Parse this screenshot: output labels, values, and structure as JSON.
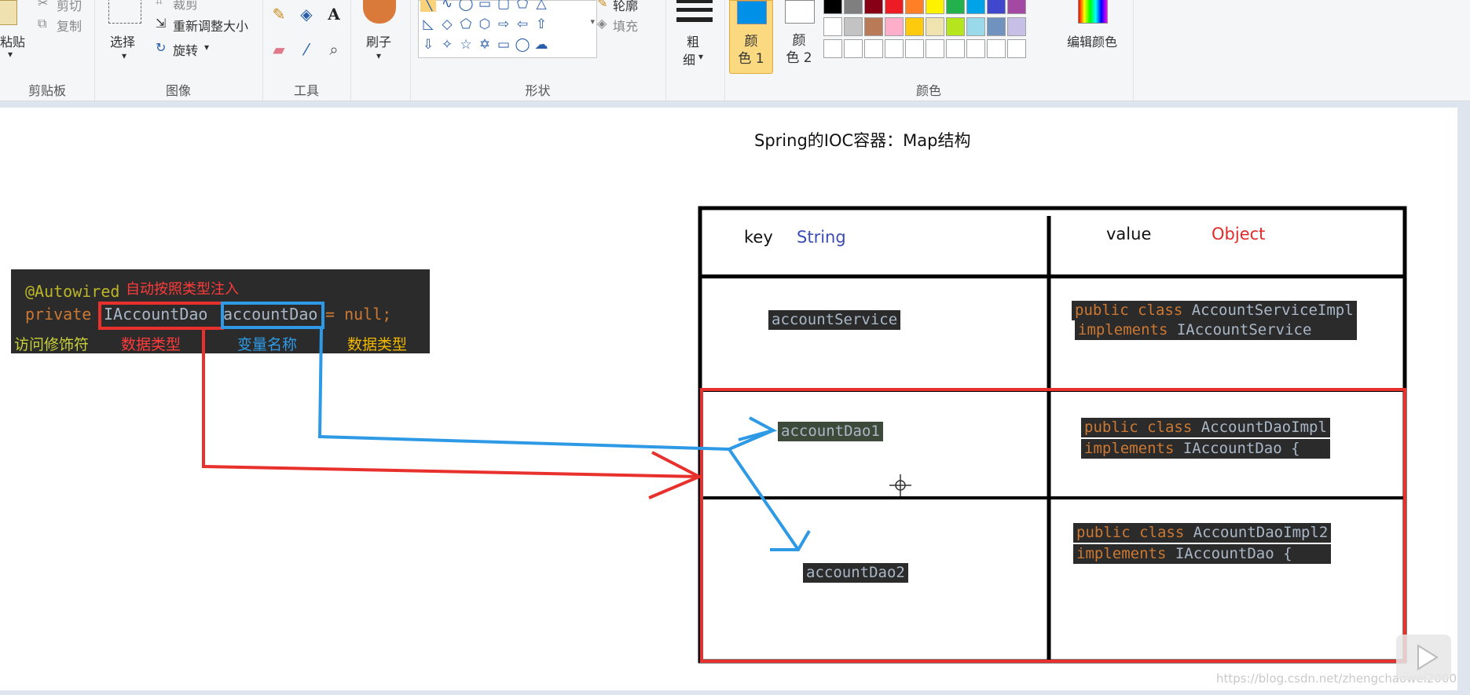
{
  "ribbon": {
    "clipboard": {
      "paste_label": "粘贴",
      "cut_label": "剪切",
      "copy_label": "复制",
      "group_label": "剪贴板"
    },
    "image": {
      "select_label": "选择",
      "crop_label": "裁剪",
      "resize_label": "重新调整大小",
      "rotate_label": "旋转",
      "group_label": "图像"
    },
    "tools": {
      "group_label": "工具",
      "text_tool": "A"
    },
    "brush": {
      "label": "刷子"
    },
    "shapes": {
      "outline_label": "轮廓",
      "fill_label": "填充",
      "group_label": "形状"
    },
    "size": {
      "label_line1": "粗",
      "label_line2": "细"
    },
    "colors": {
      "color1_line1": "颜",
      "color1_line2": "色 1",
      "color2_line1": "颜",
      "color2_line2": "色 2",
      "edit_label": "编辑颜色",
      "group_label": "颜色",
      "color1": "#0090e8",
      "color2": "#ffffff",
      "palette_row1": [
        "#000000",
        "#7f7f7f",
        "#880015",
        "#ed1c24",
        "#ff7f27",
        "#fff200",
        "#22b14c",
        "#00a2e8",
        "#3f48cc",
        "#a349a4"
      ],
      "palette_row2": [
        "#ffffff",
        "#c3c3c3",
        "#b97a57",
        "#ffaec9",
        "#ffc90e",
        "#efe4b0",
        "#b5e61d",
        "#99d9ea",
        "#7092be",
        "#c8bfe7"
      ]
    }
  },
  "canvas": {
    "title": "Spring的IOC容器：Map结构",
    "code": {
      "line1_annotation": "@Autowired",
      "line1_note": "自动按照类型注入",
      "line2_private": "private",
      "line2_type": "IAccountDao",
      "line2_name": "accountDao",
      "line2_rest": " = null;"
    },
    "labels": {
      "access_modifier": "访问修饰符",
      "data_type_red": "数据类型",
      "var_name": "变量名称",
      "data_type_yellow": "数据类型"
    },
    "table": {
      "key_header": "key",
      "key_type": "String",
      "value_header": "value",
      "value_type": "Object",
      "rows": [
        {
          "key": "accountService",
          "value_line1_kw": "public class",
          "value_line1_cls": "AccountServiceImpl",
          "value_line2_kw": "implements",
          "value_line2_rest": "IAccountService"
        },
        {
          "key": "accountDao1",
          "value_line1_kw": "public class",
          "value_line1_cls": "AccountDaoImpl",
          "value_line2_kw": "implements",
          "value_line2_rest": "IAccountDao {"
        },
        {
          "key": "accountDao2",
          "value_line1_kw": "public class",
          "value_line1_cls": "AccountDaoImpl2",
          "value_line2_kw": "implements",
          "value_line2_rest": "IAccountDao {"
        }
      ]
    },
    "watermark": "https://blog.csdn.net/zhengchaowei2000"
  }
}
